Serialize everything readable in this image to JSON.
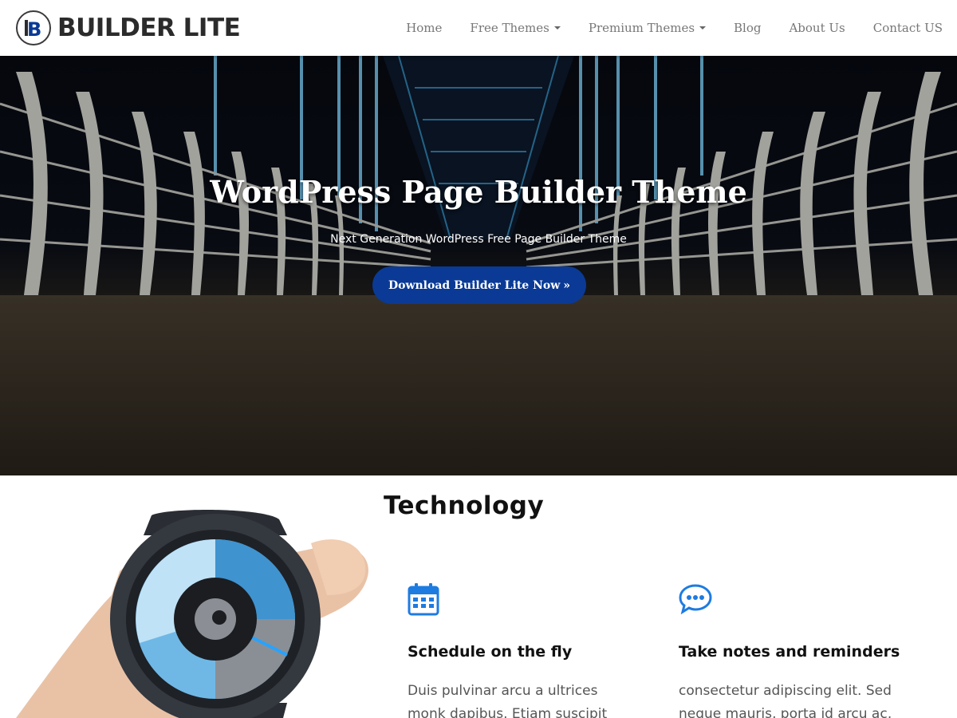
{
  "brand": {
    "logo_letter": "B",
    "name": "BUILDER LITE"
  },
  "nav": {
    "items": [
      {
        "label": "Home",
        "dropdown": false
      },
      {
        "label": "Free Themes",
        "dropdown": true
      },
      {
        "label": "Premium Themes",
        "dropdown": true
      },
      {
        "label": "Blog",
        "dropdown": false
      },
      {
        "label": "About Us",
        "dropdown": false
      },
      {
        "label": "Contact US",
        "dropdown": false
      }
    ]
  },
  "hero": {
    "title": "WordPress Page Builder Theme",
    "subtitle": "Next Generation WordPress Free Page Builder Theme",
    "button_label": "Download Builder Lite Now",
    "button_color": "#0a3a95"
  },
  "section": {
    "title": "Technology",
    "features": [
      {
        "icon": "calendar-icon",
        "title": "Schedule on the fly",
        "text": "Duis pulvinar arcu a ultrices monk dapibus. Etiam suscipit"
      },
      {
        "icon": "chat-icon",
        "title": "Take notes and reminders",
        "text": "consectetur adipiscing elit. Sed neque mauris, porta id arcu ac,"
      }
    ],
    "accent_color": "#1e7be0"
  }
}
